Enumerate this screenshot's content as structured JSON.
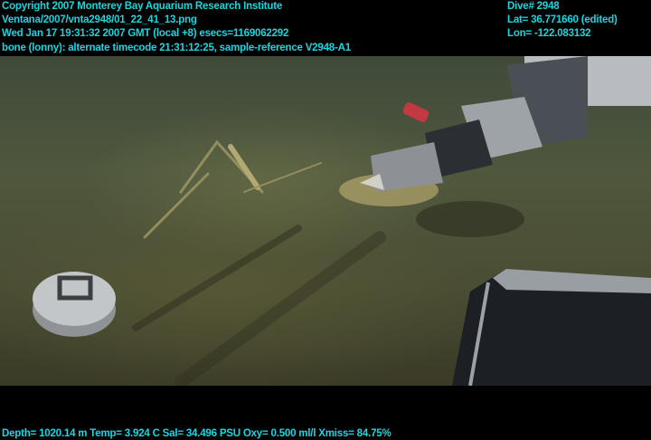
{
  "header_left": {
    "line1": "Copyright 2007 Monterey Bay Aquarium Research Institute",
    "line2": "Ventana/2007/vnta2948/01_22_41_13.png",
    "line3": "Wed Jan 17 19:31:32 2007 GMT (local +8)  esecs=1169062292",
    "line4": "bone (lonny): alternate timecode 21:31:12:25, sample-reference V2948-A1"
  },
  "header_right": {
    "dive": "Dive# 2948",
    "lat": "Lat= 36.771660 (edited)",
    "lon": "Lon= -122.083132"
  },
  "footer": {
    "telemetry": "Depth= 1020.14 m  Temp= 3.924 C  Sal= 34.496 PSU  Oxy= 0.500 ml/l  Xmiss= 84.75%"
  },
  "colors": {
    "overlay_text": "#19d6e0"
  }
}
